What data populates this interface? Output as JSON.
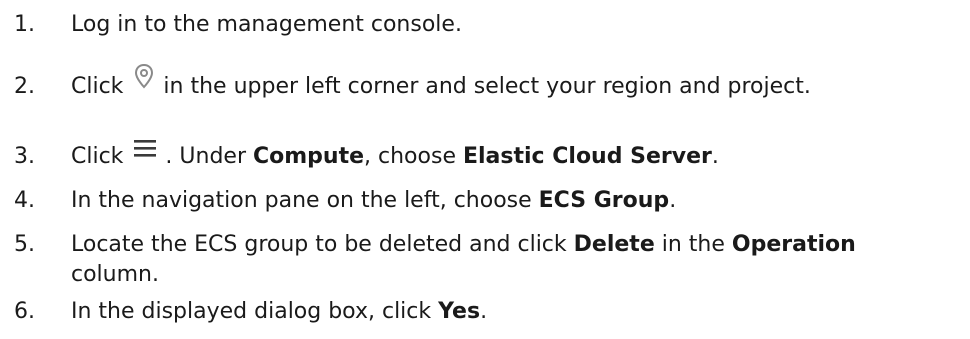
{
  "steps": [
    {
      "number": "1.",
      "text": "Log in to the management console."
    },
    {
      "number": "2.",
      "before_icon": "Click",
      "icon": "location-pin-icon",
      "after_icon": "in the upper left corner and select your region and project."
    },
    {
      "number": "3.",
      "before_icon": "Click",
      "icon": "hamburger-menu-icon",
      "after_icon": ". Under",
      "bold1": "Compute",
      "mid": ", choose",
      "bold2": "Elastic Cloud Server",
      "end": "."
    },
    {
      "number": "4.",
      "text": "In the navigation pane on the left, choose",
      "bold": "ECS Group",
      "end": "."
    },
    {
      "number": "5.",
      "text": "Locate the ECS group to be deleted and click",
      "bold1": "Delete",
      "mid": "in the",
      "bold2": "Operation",
      "line2": "column."
    },
    {
      "number": "6.",
      "text": "In the displayed dialog box, click",
      "bold": "Yes",
      "end": "."
    }
  ],
  "colors": {
    "text": "#1a1a1a",
    "icon": "#8a8a8a"
  }
}
